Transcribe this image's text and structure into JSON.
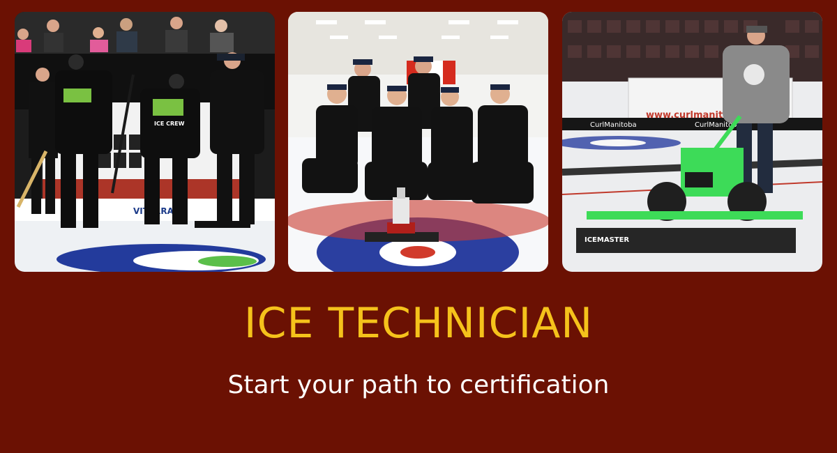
{
  "banner": {
    "title": "ICE TECHNICIAN",
    "subtitle": "Start your path to certification"
  },
  "photos": [
    {
      "jacket_text": "ICE CREW",
      "sponsor_text": "VITERRA"
    },
    {
      "scene": "team-with-trophy"
    },
    {
      "board_text": "www.curlmanitoba",
      "sponsor_text": "CurlManitoba",
      "machine_label": "ICEMASTER"
    }
  ],
  "colors": {
    "background": "#6b1103",
    "title": "#f5c21b",
    "subtitle": "#ffffff"
  }
}
